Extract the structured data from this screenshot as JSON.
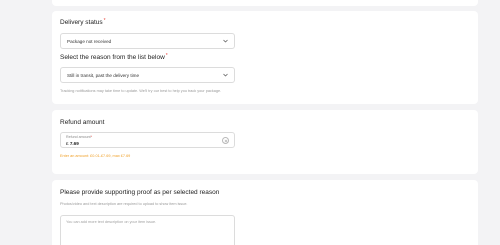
{
  "delivery": {
    "status_label": "Delivery status",
    "status_value": "Package not received",
    "reason_label": "Select the reason from the list below",
    "reason_value": "Still in transit, past the delivery time",
    "hint": "Tracking notifications may take time to update. We'll try our best to help you track your package."
  },
  "refund": {
    "title": "Refund amount",
    "field_label": "Refund amount",
    "currency": "£",
    "amount": "7.69",
    "warning": "Enter an amount: £0.01-£7.69, max £7.69"
  },
  "proof": {
    "title": "Please provide supporting proof as per selected reason",
    "subtitle": "Photos/video and text description are required to upload to show item issue.",
    "placeholder": "You can add more text description on your item issue."
  },
  "required_marker": "*",
  "colors": {
    "required": "#e8443a",
    "warning": "#f0a028",
    "background": "#f3f3f5"
  },
  "icons": {
    "dropdown": "chevron-down-icon",
    "clear": "clear-icon"
  }
}
